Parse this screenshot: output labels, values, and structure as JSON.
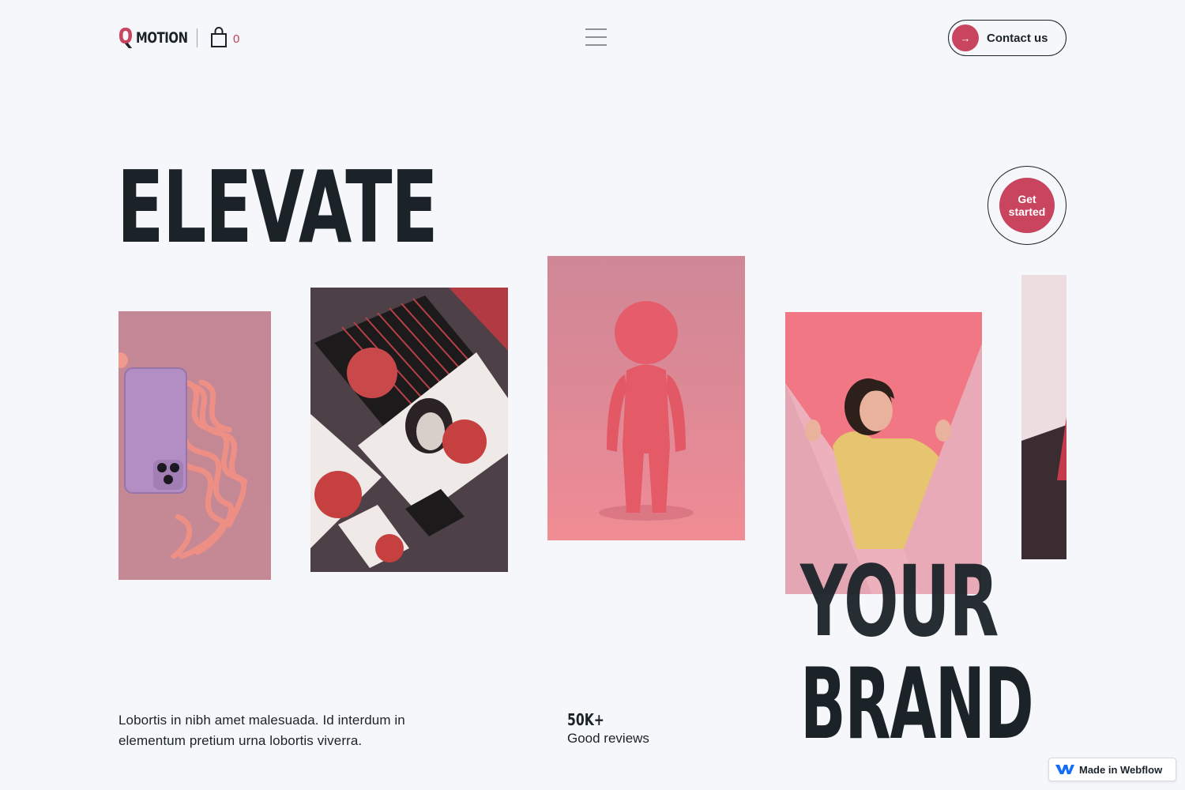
{
  "header": {
    "logo_text": "MOTION",
    "cart_count": "0",
    "menu_icon": "hamburger-icon",
    "contact_label": "Contact us",
    "contact_icon": "arrow-right-icon"
  },
  "hero": {
    "word1": "ELEVATE",
    "word2": "YOUR",
    "word3": "BRAND",
    "cta_label": "Get started"
  },
  "gallery": {
    "images": [
      "phone-on-pink-waves",
      "stationery-branding-set",
      "pink-3d-figure",
      "woman-in-yellow-hoodie",
      "cropped-image"
    ]
  },
  "footer": {
    "description": "Lobortis in nibh amet malesuada. Id interdum in elementum pretium urna lobortis viverra.",
    "stat_value": "50K+",
    "stat_label": "Good reviews"
  },
  "badge": {
    "label": "Made in Webflow"
  },
  "colors": {
    "background": "#f5f7fb",
    "accent": "#c8445f",
    "text": "#1b2329"
  }
}
